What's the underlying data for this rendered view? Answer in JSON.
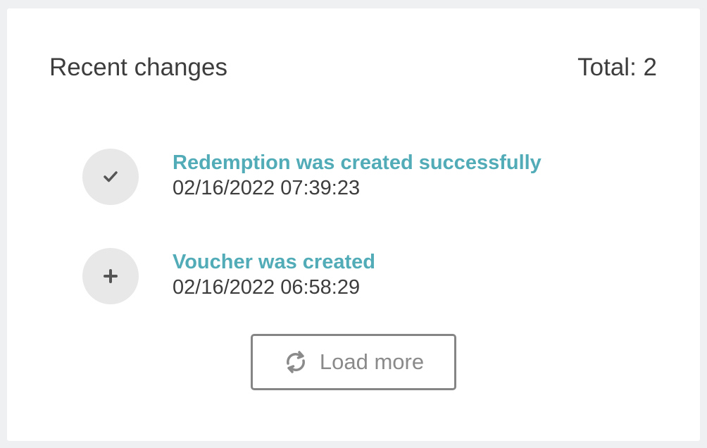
{
  "header": {
    "title": "Recent changes",
    "total": "Total: 2"
  },
  "changes": [
    {
      "icon": "checkmark-icon",
      "title": "Redemption was created successfully",
      "date": "02/16/2022 07:39:23"
    },
    {
      "icon": "plus-icon",
      "title": "Voucher was created",
      "date": "02/16/2022 06:58:29"
    }
  ],
  "load_more": {
    "label": "Load more",
    "icon": "refresh-icon"
  },
  "colors": {
    "accent": "#52acb8",
    "text": "#3d3d3d",
    "muted": "#8a8a8a",
    "circle_bg": "#e8e8e8",
    "page_bg": "#eef0f1"
  }
}
